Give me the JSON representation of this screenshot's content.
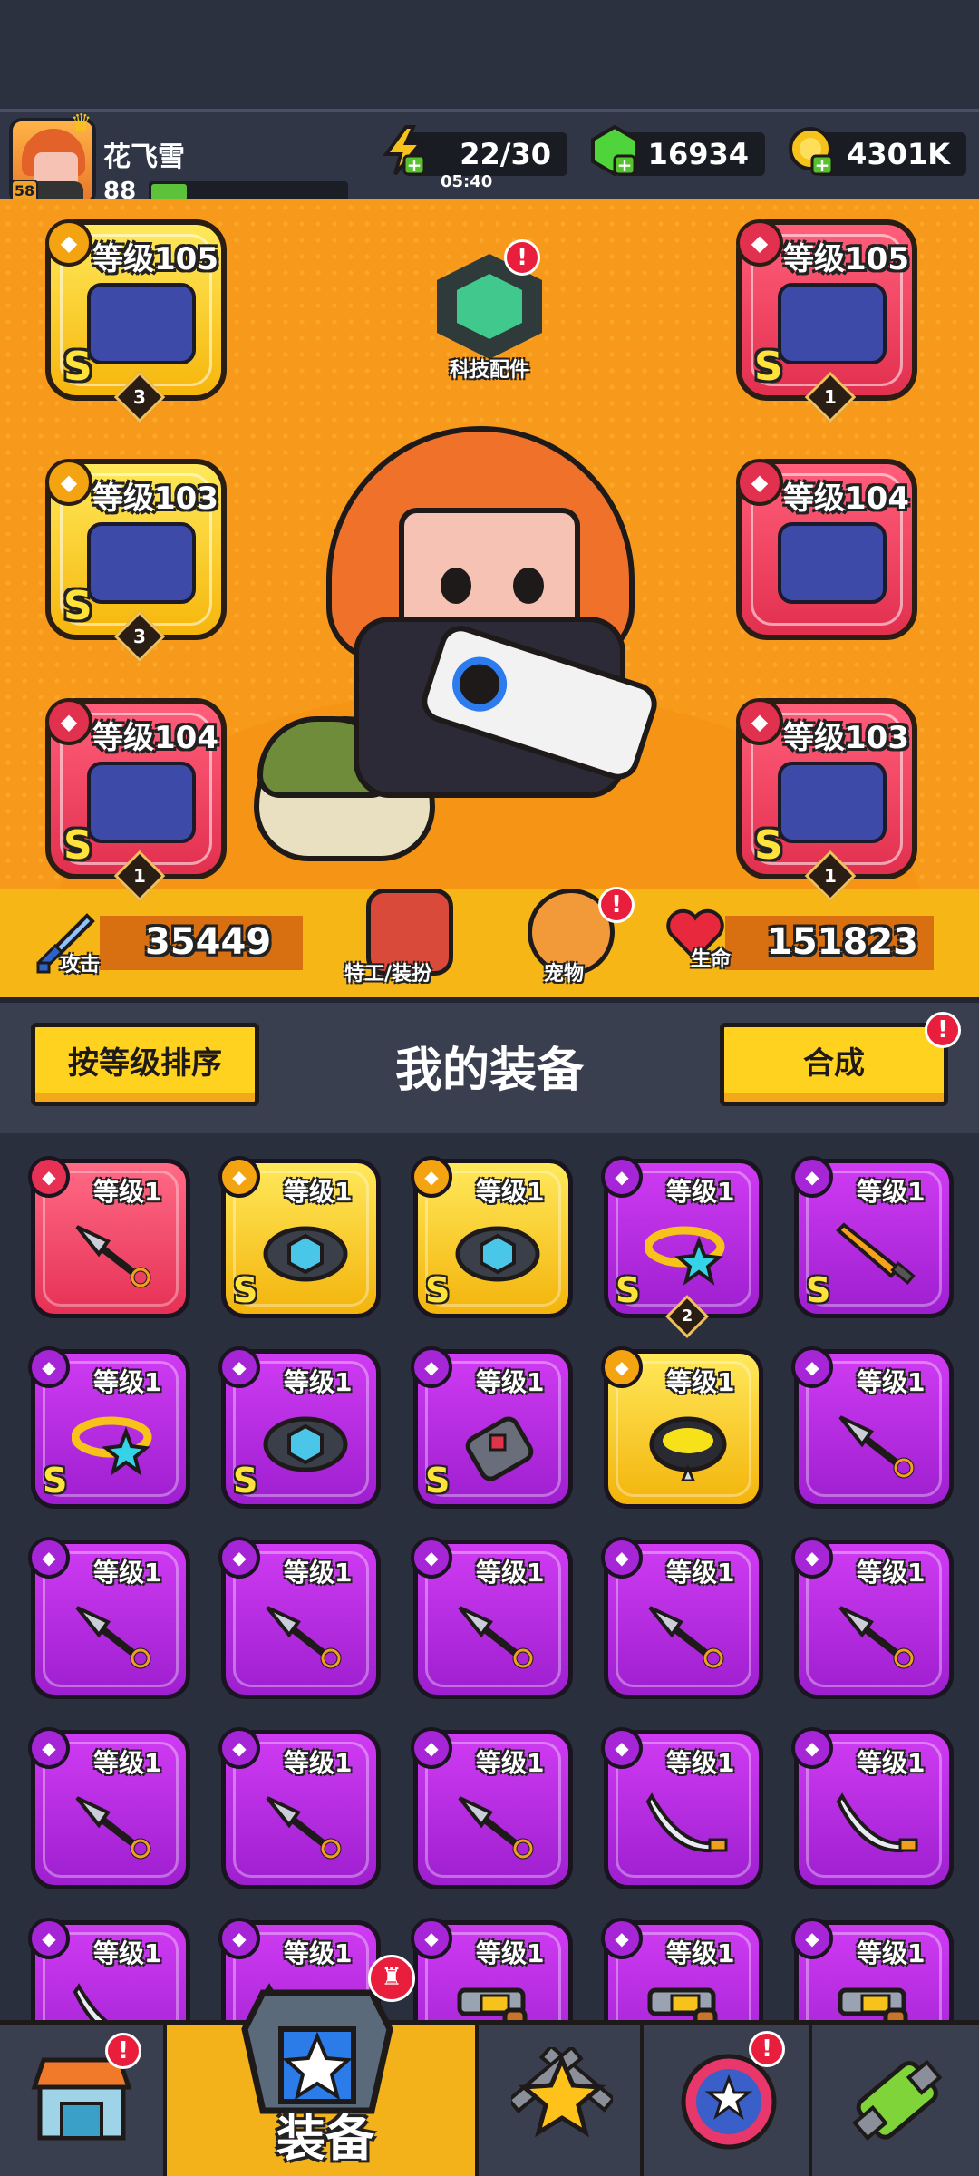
{
  "header": {
    "player_name": "花飞雪",
    "avatar_level": "58",
    "player_level": "88",
    "xp_progress": 0.18,
    "energy": "22/30",
    "energy_timer": "05:40",
    "gems": "16934",
    "gold": "4301K"
  },
  "slots": [
    {
      "level_label": "等级105",
      "grade": "S",
      "count": "3",
      "rarity": "gold"
    },
    {
      "level_label": "等级103",
      "grade": "S",
      "count": "3",
      "rarity": "gold"
    },
    {
      "level_label": "等级104",
      "grade": "S",
      "count": "1",
      "rarity": "red"
    },
    {
      "level_label": "等级105",
      "grade": "S",
      "count": "1",
      "rarity": "red"
    },
    {
      "level_label": "等级104",
      "grade": "",
      "count": "",
      "rarity": "red"
    },
    {
      "level_label": "等级103",
      "grade": "S",
      "count": "1",
      "rarity": "red"
    }
  ],
  "tech_parts": {
    "label": "科技配件",
    "alert": "!"
  },
  "stats": {
    "attack_label": "攻击",
    "attack_value": "35449",
    "agent_label": "特工/装扮",
    "pet_label": "宠物",
    "pet_alert": "!",
    "hp_label": "生命",
    "hp_value": "151823"
  },
  "equip": {
    "sort_button": "按等级排序",
    "title": "我的装备",
    "merge_button": "合成",
    "merge_alert": "!"
  },
  "grid_items": [
    {
      "level": "等级1",
      "rarity": "red",
      "grade": "",
      "count": "",
      "item": "kunai"
    },
    {
      "level": "等级1",
      "rarity": "gold",
      "grade": "S",
      "count": "",
      "item": "belt"
    },
    {
      "level": "等级1",
      "rarity": "gold",
      "grade": "S",
      "count": "",
      "item": "belt"
    },
    {
      "level": "等级1",
      "rarity": "purple",
      "grade": "S",
      "count": "2",
      "item": "ring"
    },
    {
      "level": "等级1",
      "rarity": "purple",
      "grade": "S",
      "count": "",
      "item": "sword"
    },
    {
      "level": "等级1",
      "rarity": "purple",
      "grade": "S",
      "count": "",
      "item": "ring"
    },
    {
      "level": "等级1",
      "rarity": "purple",
      "grade": "S",
      "count": "",
      "item": "belt"
    },
    {
      "level": "等级1",
      "rarity": "purple",
      "grade": "S",
      "count": "",
      "item": "glove"
    },
    {
      "level": "等级1",
      "rarity": "gold",
      "grade": "",
      "count": "",
      "item": "collar"
    },
    {
      "level": "等级1",
      "rarity": "purple",
      "grade": "",
      "count": "",
      "item": "kunai"
    },
    {
      "level": "等级1",
      "rarity": "purple",
      "grade": "",
      "count": "",
      "item": "kunai"
    },
    {
      "level": "等级1",
      "rarity": "purple",
      "grade": "",
      "count": "",
      "item": "kunai"
    },
    {
      "level": "等级1",
      "rarity": "purple",
      "grade": "",
      "count": "",
      "item": "kunai"
    },
    {
      "level": "等级1",
      "rarity": "purple",
      "grade": "",
      "count": "",
      "item": "kunai"
    },
    {
      "level": "等级1",
      "rarity": "purple",
      "grade": "",
      "count": "",
      "item": "kunai"
    },
    {
      "level": "等级1",
      "rarity": "purple",
      "grade": "",
      "count": "",
      "item": "kunai"
    },
    {
      "level": "等级1",
      "rarity": "purple",
      "grade": "",
      "count": "",
      "item": "kunai"
    },
    {
      "level": "等级1",
      "rarity": "purple",
      "grade": "",
      "count": "",
      "item": "kunai"
    },
    {
      "level": "等级1",
      "rarity": "purple",
      "grade": "",
      "count": "",
      "item": "saber"
    },
    {
      "level": "等级1",
      "rarity": "purple",
      "grade": "",
      "count": "",
      "item": "saber"
    },
    {
      "level": "等级1",
      "rarity": "purple",
      "grade": "",
      "count": "",
      "item": "saber"
    },
    {
      "level": "等级1",
      "rarity": "purple",
      "grade": "",
      "count": "",
      "item": "saber"
    },
    {
      "level": "等级1",
      "rarity": "purple",
      "grade": "",
      "count": "",
      "item": "revolver"
    },
    {
      "level": "等级1",
      "rarity": "purple",
      "grade": "",
      "count": "",
      "item": "revolver"
    },
    {
      "level": "等级1",
      "rarity": "purple",
      "grade": "",
      "count": "",
      "item": "revolver"
    }
  ],
  "nav": {
    "shop_alert": "!",
    "equip_label": "装备",
    "equip_alert": "",
    "orb_alert": "!"
  },
  "icons": [
    "lightning-icon",
    "gem-icon",
    "gold-coin-icon",
    "plus-icon",
    "sword-icon",
    "heart-icon",
    "shop-icon",
    "star-icon",
    "orb-icon",
    "potion-icon"
  ],
  "colors": {
    "stage": "#f79a1c",
    "accent": "#ffd21f",
    "purple": "#b22ee0",
    "red": "#e63155",
    "gold": "#f3b40c"
  }
}
